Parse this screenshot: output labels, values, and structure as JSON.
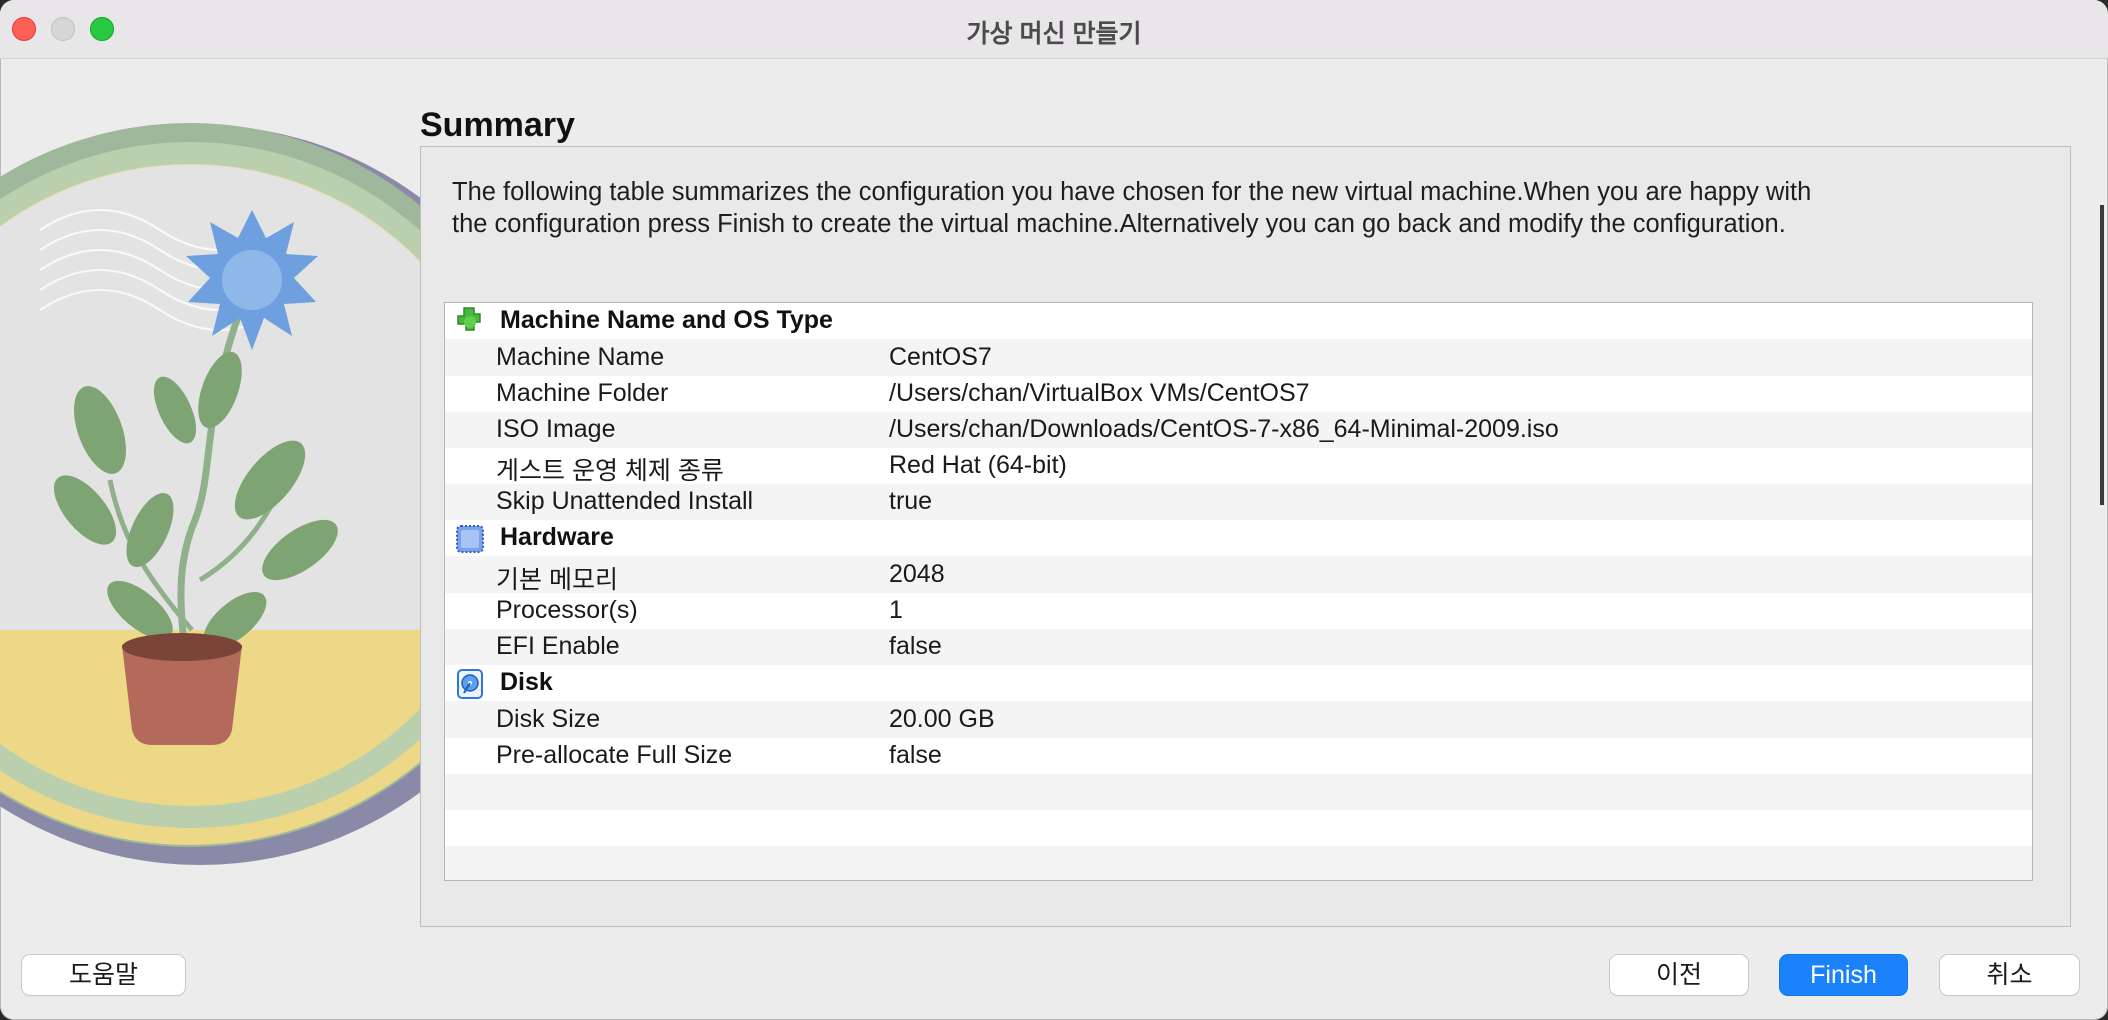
{
  "window": {
    "title": "가상 머신 만들기"
  },
  "page": {
    "heading": "Summary",
    "description": "The following table summarizes the configuration you have chosen for the new virtual machine.When you are happy with the configuration press Finish to create the virtual machine.Alternatively you can go back and modify the configuration."
  },
  "sections": [
    {
      "title": "Machine Name and OS Type",
      "icon": "puzzle-icon",
      "rows": [
        {
          "key": "Machine Name",
          "value": "CentOS7"
        },
        {
          "key": "Machine Folder",
          "value": "/Users/chan/VirtualBox VMs/CentOS7"
        },
        {
          "key": "ISO Image",
          "value": "/Users/chan/Downloads/CentOS-7-x86_64-Minimal-2009.iso"
        },
        {
          "key": "게스트 운영 체제 종류",
          "value": "Red Hat (64-bit)"
        },
        {
          "key": "Skip Unattended Install",
          "value": "true"
        }
      ]
    },
    {
      "title": "Hardware",
      "icon": "chip-icon",
      "rows": [
        {
          "key": "기본 메모리",
          "value": "2048"
        },
        {
          "key": "Processor(s)",
          "value": "1"
        },
        {
          "key": "EFI Enable",
          "value": "false"
        }
      ]
    },
    {
      "title": "Disk",
      "icon": "disk-icon",
      "rows": [
        {
          "key": "Disk Size",
          "value": "20.00 GB"
        },
        {
          "key": "Pre-allocate Full Size",
          "value": "false"
        }
      ]
    }
  ],
  "buttons": {
    "help": "도움말",
    "back": "이전",
    "finish": "Finish",
    "cancel": "취소"
  },
  "colors": {
    "accent": "#1a82fb",
    "close": "#fe5f57",
    "maximize": "#28c840",
    "puzzle": "#49b83a"
  }
}
